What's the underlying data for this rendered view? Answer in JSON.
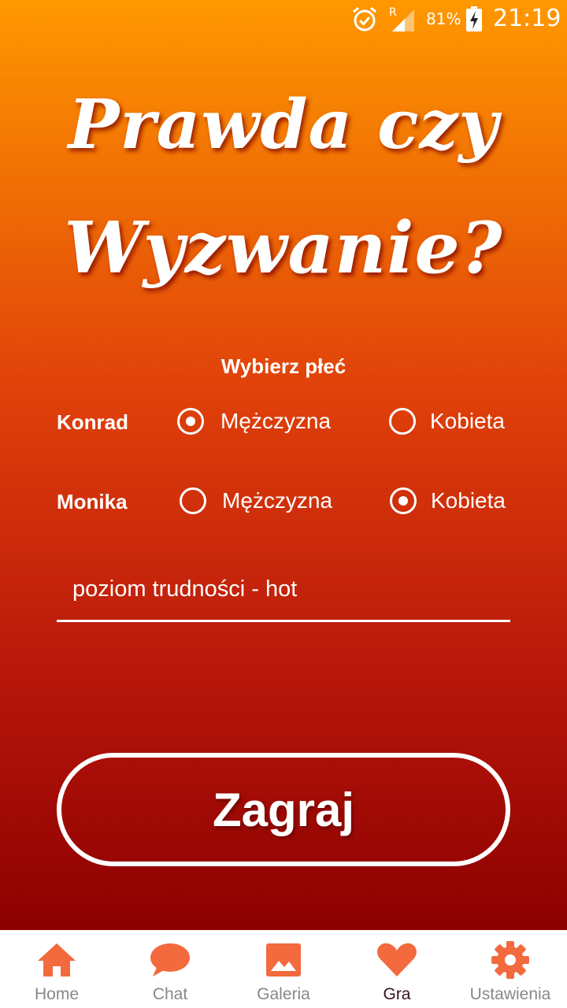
{
  "status_bar": {
    "battery_percent": "81%",
    "time": "21:19"
  },
  "title": {
    "line1": "Prawda czy",
    "line2": "Wyzwanie?"
  },
  "gender_section": {
    "heading": "Wybierz płeć",
    "players": [
      {
        "name": "Konrad",
        "option_male": "Mężczyzna",
        "option_female": "Kobieta",
        "selected": "male"
      },
      {
        "name": "Monika",
        "option_male": "Mężczyzna",
        "option_female": "Kobieta",
        "selected": "female"
      }
    ]
  },
  "difficulty": {
    "value": "poziom trudności - hot"
  },
  "play_button": {
    "label": "Zagraj"
  },
  "colors": {
    "accent": "#f26a3d",
    "gradient_top": "#ff9800",
    "gradient_bottom": "#8c0000"
  },
  "bottom_nav": {
    "items": [
      {
        "label": "Home",
        "icon": "home-icon"
      },
      {
        "label": "Chat",
        "icon": "chat-icon"
      },
      {
        "label": "Galeria",
        "icon": "gallery-icon"
      },
      {
        "label": "Gra",
        "icon": "heart-icon",
        "active": true
      },
      {
        "label": "Ustawienia",
        "icon": "gear-icon"
      }
    ]
  }
}
